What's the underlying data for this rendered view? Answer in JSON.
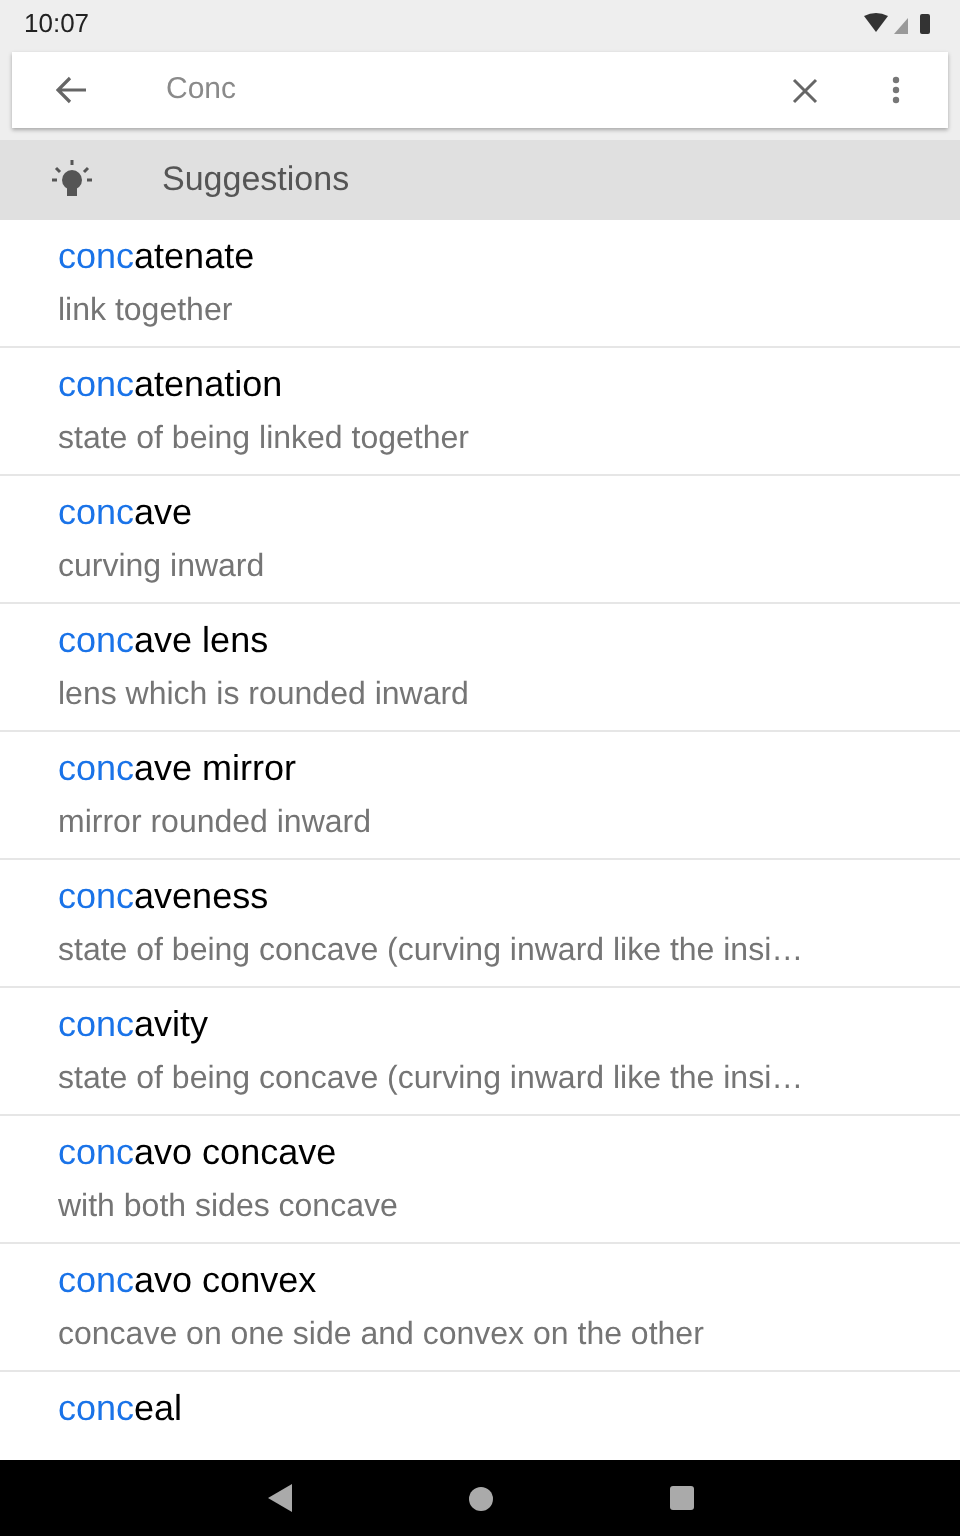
{
  "status_bar": {
    "time": "10:07"
  },
  "search": {
    "value": "Conc"
  },
  "section_header": {
    "title": "Suggestions"
  },
  "suggestions": [
    {
      "match": "conc",
      "rest": "atenate",
      "definition": "link together"
    },
    {
      "match": "conc",
      "rest": "atenation",
      "definition": "state of being linked together"
    },
    {
      "match": "conc",
      "rest": "ave",
      "definition": "curving inward"
    },
    {
      "match": "conc",
      "rest": "ave lens",
      "definition": "lens which is rounded inward"
    },
    {
      "match": "conc",
      "rest": "ave mirror",
      "definition": "mirror rounded inward"
    },
    {
      "match": "conc",
      "rest": "aveness",
      "definition": "state of being concave (curving inward like the insi…"
    },
    {
      "match": "conc",
      "rest": "avity",
      "definition": "state of being concave (curving inward like the insi…"
    },
    {
      "match": "conc",
      "rest": "avo concave",
      "definition": "with both sides concave"
    },
    {
      "match": "conc",
      "rest": "avo convex",
      "definition": "concave on one side and convex on the other"
    },
    {
      "match": "conc",
      "rest": "eal"
    }
  ]
}
